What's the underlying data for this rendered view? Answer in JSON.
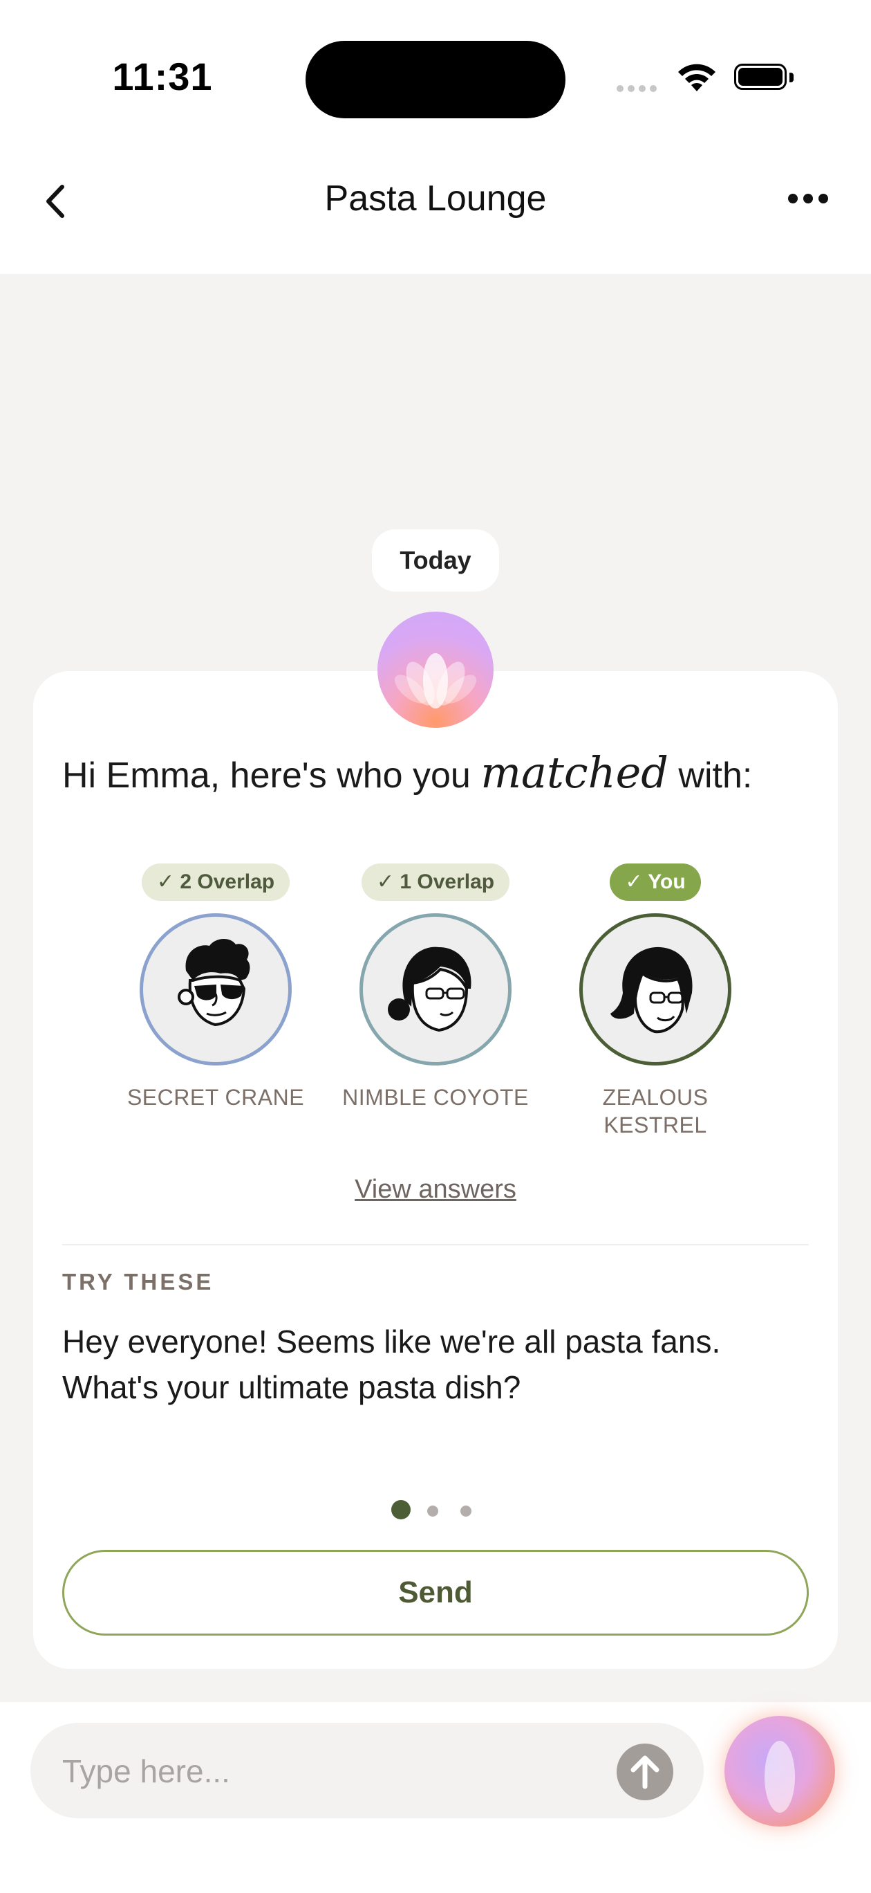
{
  "status_bar": {
    "time": "11:31"
  },
  "nav": {
    "title": "Pasta Lounge"
  },
  "chat": {
    "date_label": "Today",
    "greeting_before": "Hi Emma, here's who you ",
    "greeting_emphasis": "matched",
    "greeting_after": " with:",
    "members": [
      {
        "badge": "✓ 2 Overlap",
        "name": "SECRET CRANE",
        "ring_color": "#8aa2cd",
        "badge_style": "overlap"
      },
      {
        "badge": "✓ 1 Overlap",
        "name": "NIMBLE COYOTE",
        "ring_color": "#84a6ac",
        "badge_style": "overlap"
      },
      {
        "badge": "✓ You",
        "name": "ZEALOUS KESTREL",
        "ring_color": "#4b5e35",
        "badge_style": "you"
      }
    ],
    "view_answers": "View answers",
    "try_label": "TRY THESE",
    "suggestion": "Hey everyone! Seems like we're all pasta fans. What's your ultimate pasta dish?",
    "pager": {
      "total": 3,
      "active": 1
    },
    "send_label": "Send"
  },
  "composer": {
    "placeholder": "Type here..."
  },
  "colors": {
    "accent_green": "#4d5a33",
    "badge_you": "#85a64a",
    "badge_overlap_bg": "#e6ead7"
  }
}
